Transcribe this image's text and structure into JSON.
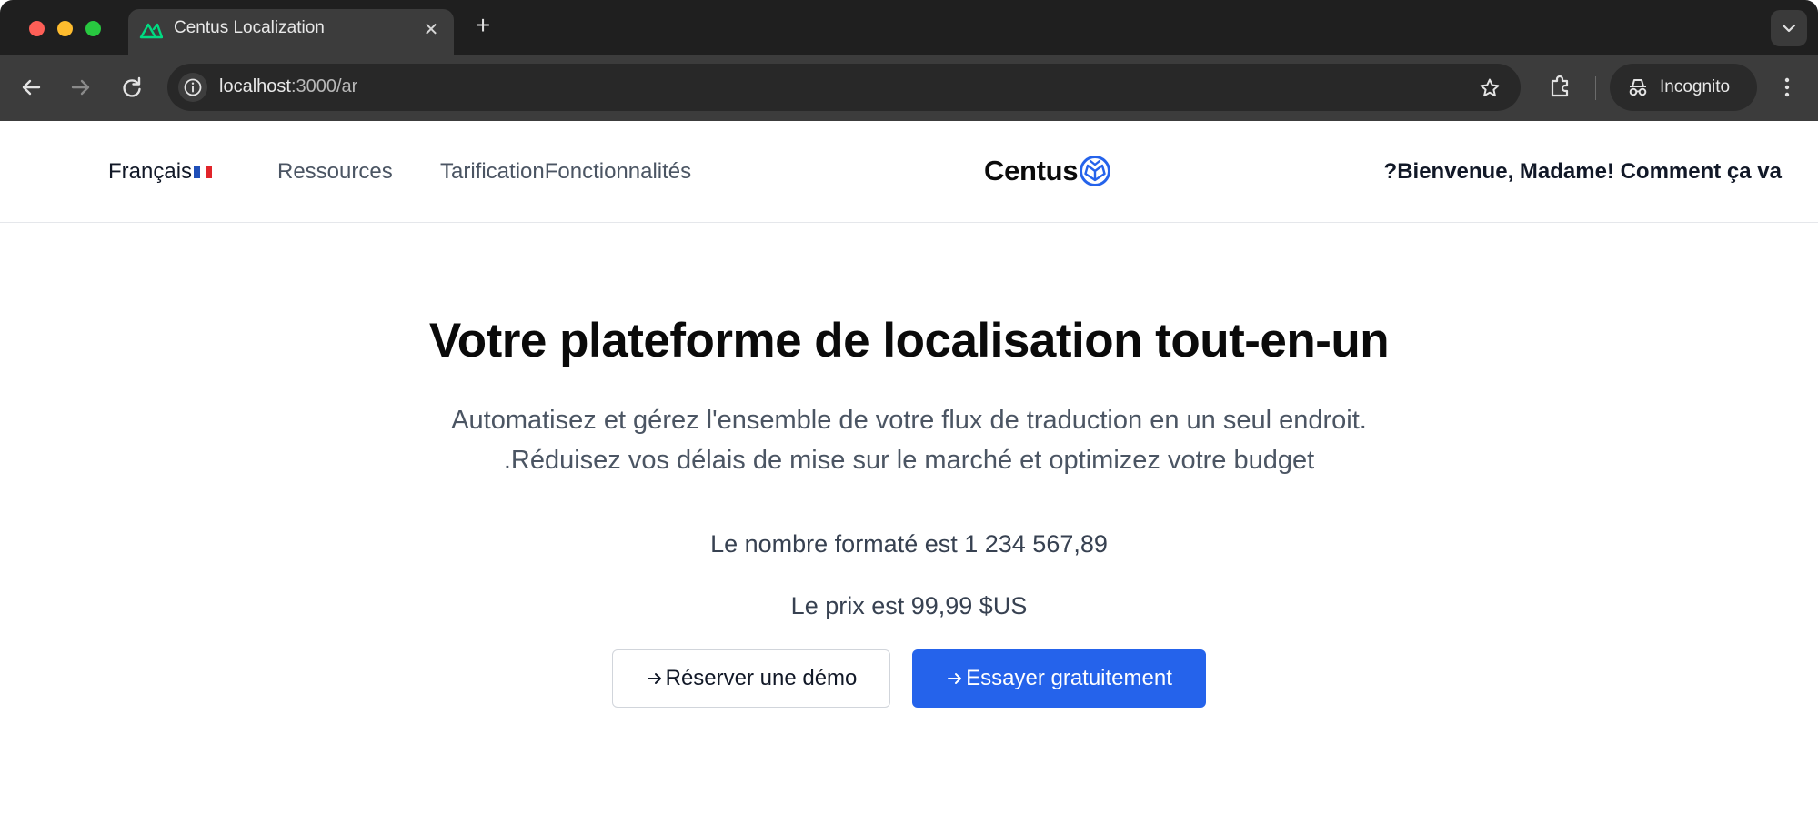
{
  "browser": {
    "tab_title": "Centus Localization",
    "url_host": "localhost",
    "url_path": ":3000/ar",
    "incognito_label": "Incognito",
    "icons": [
      "nuxt-icon",
      "close-icon",
      "plus-icon",
      "chevron-down-icon",
      "back-arrow-icon",
      "forward-arrow-icon",
      "reload-icon",
      "info-icon",
      "star-icon",
      "extensions-icon",
      "incognito-icon",
      "kebab-menu-icon"
    ]
  },
  "header": {
    "language": "Français",
    "nav": [
      "Ressources",
      "TarificationFonctionnalités"
    ],
    "brand": "Centus",
    "greeting": "?Bienvenue, Madame! Comment ça va"
  },
  "hero": {
    "title": "Votre plateforme de localisation tout-en-un",
    "subtitle_line1": "Automatisez et gérez l'ensemble de votre flux de traduction en un seul endroit.",
    "subtitle_line2": ".Réduisez vos délais de mise sur le marché et optimizez votre budget",
    "formatted_number": "Le nombre formaté est 1 234 567,89",
    "price": "Le prix est 99,99 $US",
    "demo_button": "Réserver une démo",
    "trial_button": "Essayer gratuitement"
  },
  "colors": {
    "primary": "#2563eb",
    "brand_logo": "#2563eb",
    "chrome_dark": "#1f1f1f",
    "toolbar": "#3c3c3c"
  }
}
